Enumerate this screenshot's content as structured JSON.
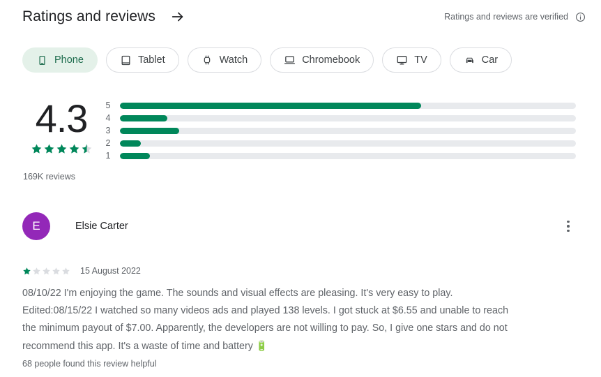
{
  "header": {
    "title": "Ratings and reviews",
    "arrow_icon": "arrow-right-icon",
    "verified_text": "Ratings and reviews are verified",
    "info_icon": "info-icon"
  },
  "device_filters": [
    {
      "label": "Phone",
      "icon": "phone-icon",
      "selected": true
    },
    {
      "label": "Tablet",
      "icon": "tablet-icon",
      "selected": false
    },
    {
      "label": "Watch",
      "icon": "watch-icon",
      "selected": false
    },
    {
      "label": "Chromebook",
      "icon": "laptop-icon",
      "selected": false
    },
    {
      "label": "TV",
      "icon": "tv-icon",
      "selected": false
    },
    {
      "label": "Car",
      "icon": "car-icon",
      "selected": false
    }
  ],
  "summary": {
    "score": "4.3",
    "stars_filled": 4,
    "stars_half": 1,
    "review_count": "169K reviews"
  },
  "chart_data": {
    "type": "bar",
    "title": "Rating distribution",
    "orientation": "horizontal",
    "categories": [
      "5",
      "4",
      "3",
      "2",
      "1"
    ],
    "values": [
      66,
      10.4,
      13,
      4.6,
      6.6
    ],
    "xlabel": "",
    "ylabel": "",
    "xlim": [
      0,
      100
    ],
    "grid": false,
    "legend": "none",
    "bar_color": "#00875a",
    "track_color": "#e8eaed"
  },
  "review": {
    "avatar_initial": "E",
    "avatar_color": "#9328b8",
    "reviewer_name": "Elsie Carter",
    "overflow_icon": "more-vert-icon",
    "rating": 1,
    "date": "15 August 2022",
    "text_line_1": "08/10/22 I'm enjoying the game. The sounds and visual effects are pleasing. It's very easy to play.",
    "text_line_2": "Edited:08/15/22 I watched so many videos ads and played 138 levels. I got stuck at $6.55 and unable to reach",
    "text_line_3": "the minimum payout of $7.00. Apparently, the developers are not willing to pay. So, I give one stars and do not",
    "text_line_4": "recommend this app. It's a waste of time and battery",
    "battery_emoji": "🔋",
    "helpful": "68 people found this review helpful"
  },
  "colors": {
    "accent_green": "#00875a",
    "chip_selected_bg": "#e4f1e9",
    "chip_selected_text": "#1c6b4c",
    "track_gray": "#e8eaed",
    "text_secondary": "#5f6368"
  }
}
